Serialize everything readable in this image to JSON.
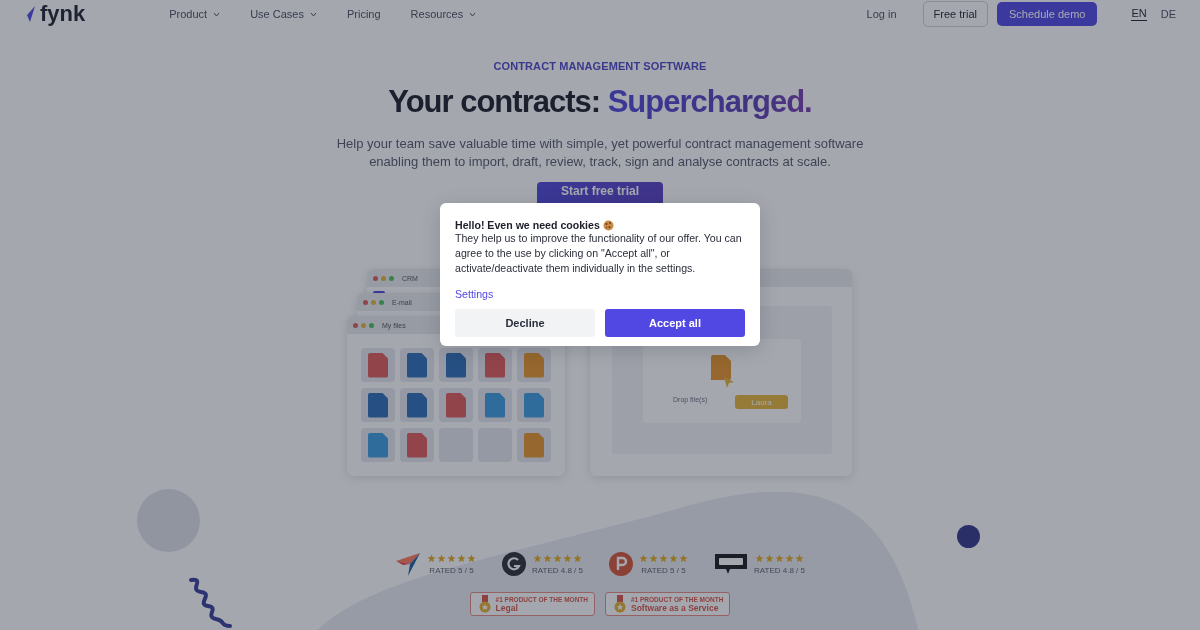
{
  "header": {
    "logo": "fynk",
    "nav": [
      {
        "label": "Product",
        "has_menu": true
      },
      {
        "label": "Use Cases",
        "has_menu": true
      },
      {
        "label": "Pricing",
        "has_menu": false
      },
      {
        "label": "Resources",
        "has_menu": true
      }
    ],
    "login": "Log in",
    "free_trial": "Free trial",
    "schedule_demo": "Schedule demo",
    "languages": [
      {
        "label": "EN",
        "selected": true
      },
      {
        "label": "DE",
        "selected": false
      }
    ]
  },
  "hero": {
    "eyebrow": "CONTRACT MANAGEMENT SOFTWARE",
    "headline": "Your contracts:",
    "headline_highlight": "Supercharged.",
    "description": "Help your team save valuable time with simple, yet powerful contract management software enabling them to import, draft, review, track, sign and analyse contracts at scale.",
    "cta": "Start free trial"
  },
  "mockup": {
    "windows": [
      {
        "title": "CRM"
      },
      {
        "title": "E-mail"
      },
      {
        "title": "My files"
      }
    ],
    "files": [
      {
        "kind": "pdf"
      },
      {
        "kind": "docx"
      },
      {
        "kind": "docx"
      },
      {
        "kind": "pdf"
      },
      {
        "kind": "tiff"
      },
      {
        "kind": "docx"
      },
      {
        "kind": "docx"
      },
      {
        "kind": "pdf"
      },
      {
        "kind": "jpeg"
      },
      {
        "kind": "jpeg"
      },
      {
        "kind": "jpeg"
      },
      {
        "kind": "pdf"
      },
      {
        "kind": "empty"
      },
      {
        "kind": "empty"
      },
      {
        "kind": "tiff"
      }
    ],
    "drop_zone": {
      "label": "Drop file(s)",
      "cursor_name": "Laura"
    }
  },
  "ratings": [
    {
      "kind": "plane",
      "stars": 5,
      "text": "RATED 5 / 5"
    },
    {
      "kind": "g2",
      "stars": 5,
      "text": "RATED 4.8 / 5"
    },
    {
      "kind": "p",
      "stars": 5,
      "text": "RATED 5 / 5"
    },
    {
      "kind": "omr",
      "stars": 5,
      "text": "RATED 4.8 / 5"
    }
  ],
  "awards": [
    {
      "title": "#1 PRODUCT OF THE MONTH",
      "category": "Legal"
    },
    {
      "title": "#1 PRODUCT OF THE MONTH",
      "category": "Software as a Service"
    }
  ],
  "cookie_dialog": {
    "title": "Hello! Even we need cookies",
    "body": "They help us to improve the functionality of our offer. You can agree to the use by clicking on \"Accept all\", or activate/deactivate them individually in the settings.",
    "settings_link": "Settings",
    "decline": "Decline",
    "accept": "Accept all"
  }
}
